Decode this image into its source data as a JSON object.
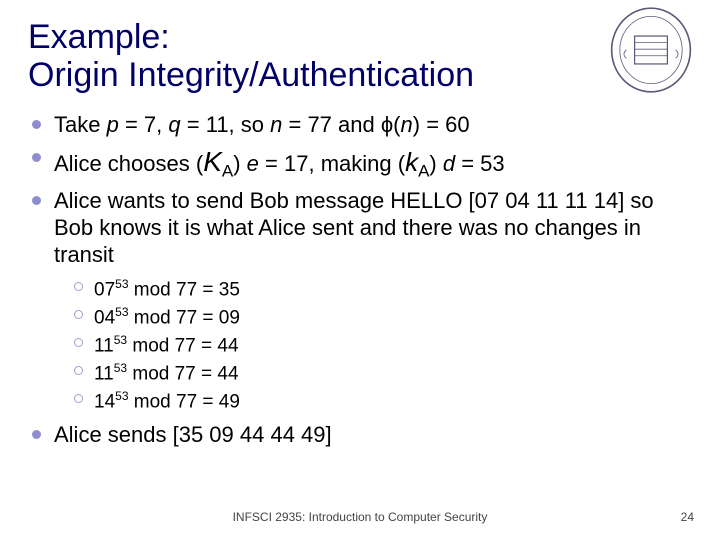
{
  "title_line1": "Example:",
  "title_line2": "Origin Integrity/Authentication",
  "bullets": {
    "b1_pre": "Take ",
    "b1_p": "p",
    "b1_mid1": " = 7, ",
    "b1_q": "q",
    "b1_mid2": " = 11, so ",
    "b1_n": "n",
    "b1_mid3": " = 77 and ϕ(",
    "b1_n2": "n",
    "b1_end": ") = 60",
    "b2_pre": "Alice chooses (",
    "b2_K": "K",
    "b2_A1": "A",
    "b2_mid1": ") ",
    "b2_e": "e",
    "b2_mid2": " = 17, making (",
    "b2_k": "k",
    "b2_A2": "A",
    "b2_mid3": ") ",
    "b2_d": "d",
    "b2_end": " = 53",
    "b3": "Alice wants to send Bob message HELLO [07 04 11 11 14] so Bob knows it is what Alice sent and there was no changes in transit",
    "b4": "Alice sends [35 09 44 44 49]"
  },
  "sub": [
    {
      "b": "07",
      "e": "53",
      "m": " mod 77 = 35"
    },
    {
      "b": "04",
      "e": "53",
      "m": " mod 77 = 09"
    },
    {
      "b": "11",
      "e": "53",
      "m": " mod 77 = 44"
    },
    {
      "b": "11",
      "e": "53",
      "m": " mod 77 = 44"
    },
    {
      "b": "14",
      "e": "53",
      "m": " mod 77 = 49"
    }
  ],
  "footer_center": "INFSCI 2935: Introduction to Computer Security",
  "footer_right": "24"
}
